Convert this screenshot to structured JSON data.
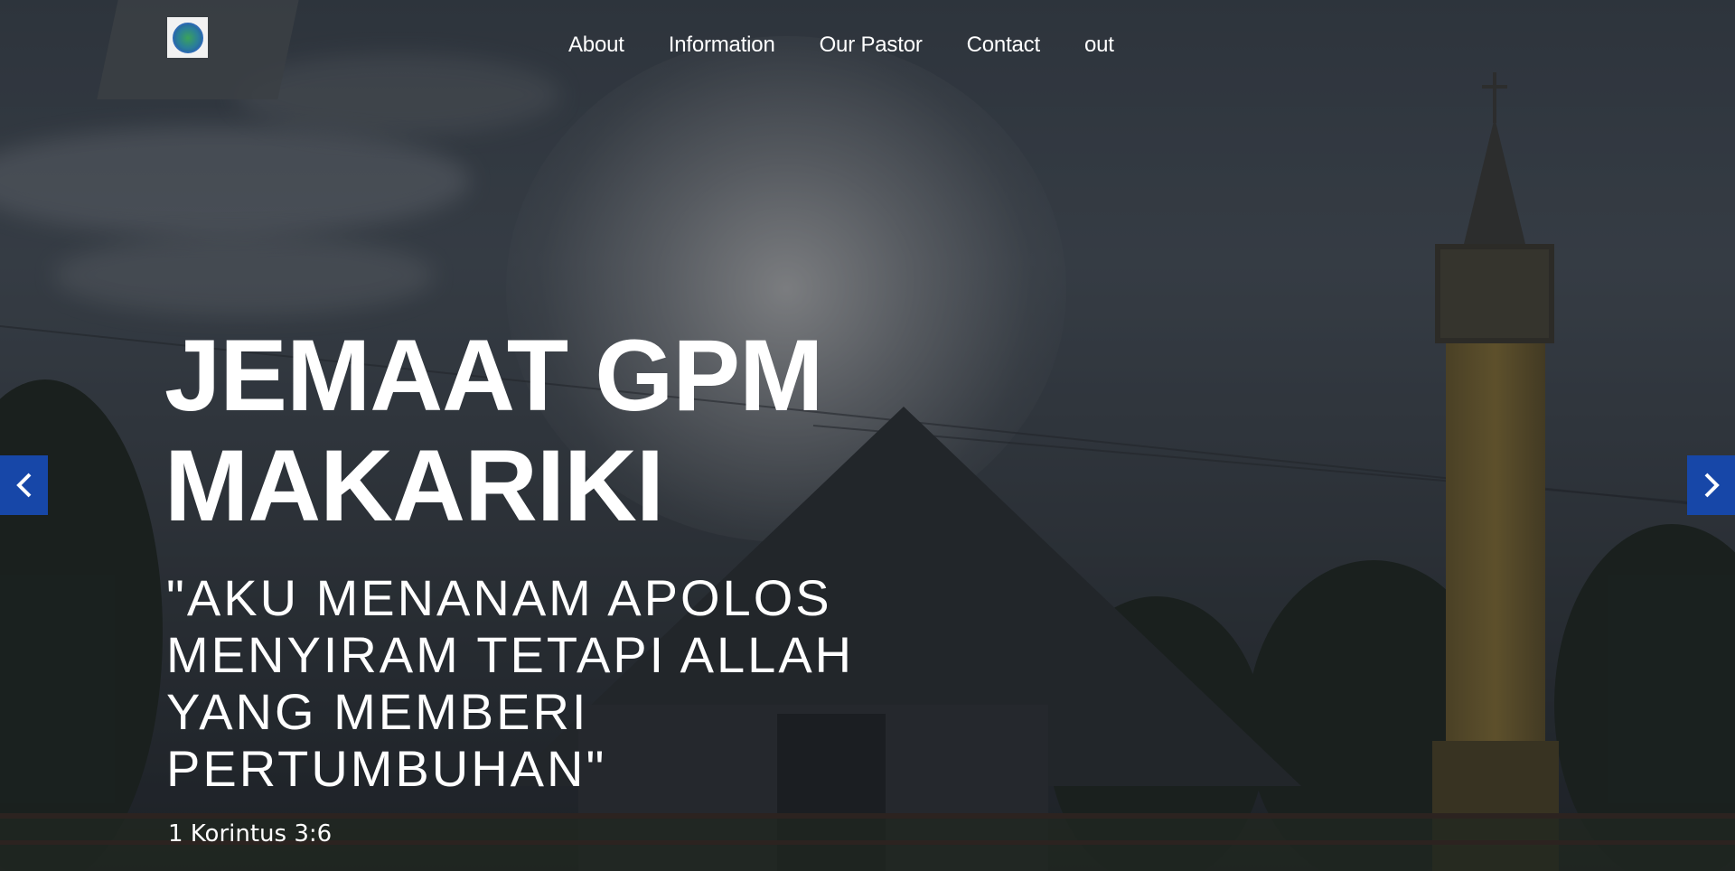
{
  "header": {
    "logo_icon": "church-emblem-icon",
    "nav": [
      {
        "label": "About"
      },
      {
        "label": "Information"
      },
      {
        "label": "Our Pastor"
      },
      {
        "label": "Contact"
      },
      {
        "label": "out"
      }
    ]
  },
  "hero": {
    "title_line1": "JEMAAT GPM",
    "title_line2": "MAKARIKI",
    "quote_line1": "\"AKU MENANAM APOLOS",
    "quote_line2": "MENYIRAM TETAPI ALLAH",
    "quote_line3": "YANG MEMBERI",
    "quote_line4": "PERTUMBUHAN\"",
    "reference": "1 Korintus 3:6"
  },
  "carousel": {
    "prev_icon": "chevron-left-icon",
    "next_icon": "chevron-right-icon",
    "accent_color": "#1747a8"
  }
}
